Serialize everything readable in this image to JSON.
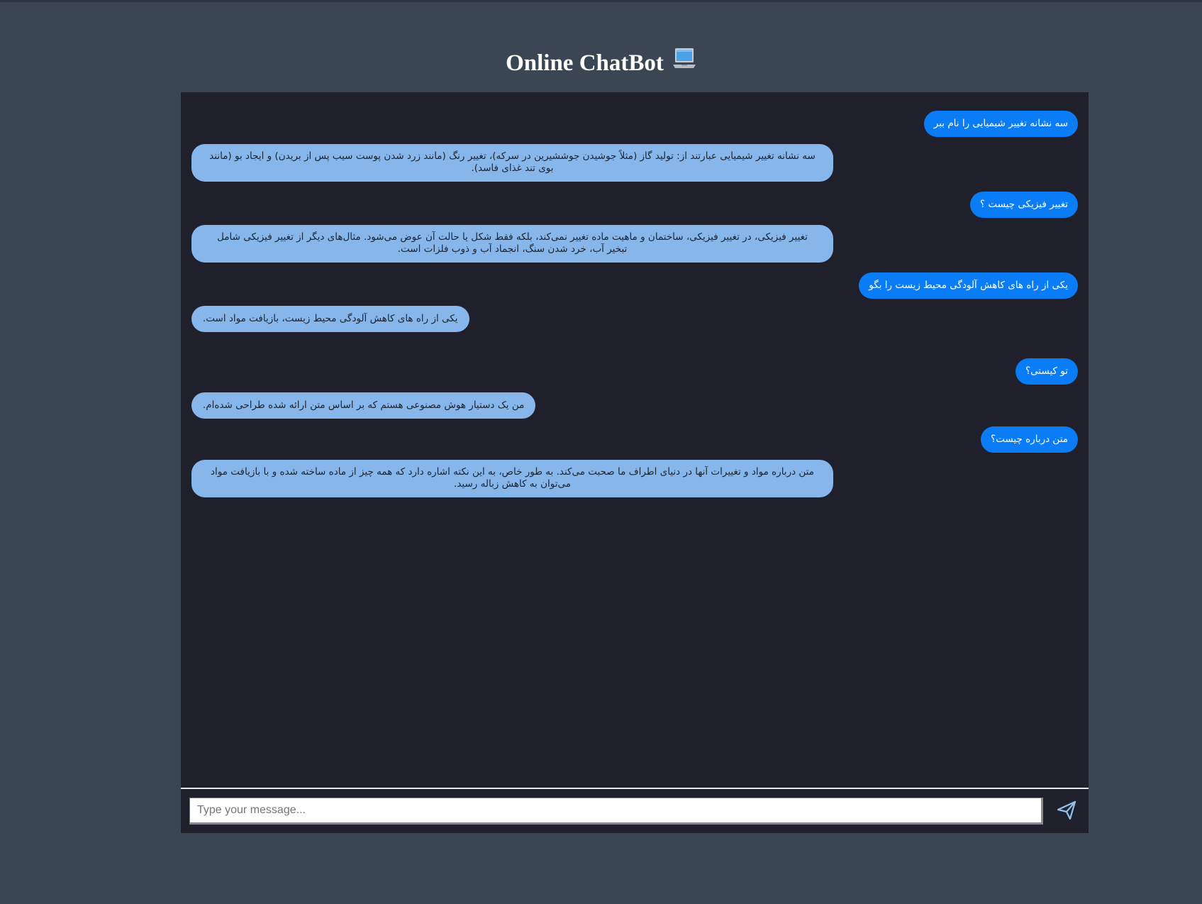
{
  "app": {
    "title": "Online ChatBot",
    "title_icon": "laptop-icon"
  },
  "messages": [
    {
      "role": "user",
      "text": "سه نشانه تغییر شیمیایی را نام ببر"
    },
    {
      "role": "bot",
      "text": "سه نشانه تغییر شیمیایی عبارتند از: تولید گاز (مثلاً جوشیدن جوششیرین در سرکه)، تغییر رنگ (مانند زرد شدن پوست سیب پس از بریدن) و ایجاد بو (مانند بوی تند غذای فاسد)."
    },
    {
      "role": "user",
      "text": "تغییر فیزیکی چیست ؟"
    },
    {
      "role": "bot",
      "text": "تغییر فیزیکی، در تغییر فیزیکی، ساختمان و ماهیت ماده تغییر نمی‌کند، بلکه فقط شکل یا حالت آن عوض می‌شود. مثال‌های دیگر از تغییر فیزیکی شامل تبخیر آب، خرد شدن سنگ، انجماد آب و ذوب فلزات است."
    },
    {
      "role": "user",
      "text": "یکی از راه های کاهش آلودگی محیط زیست را بگو"
    },
    {
      "role": "bot",
      "text": "یکی از راه های کاهش آلودگی محیط زیست، بازیافت مواد است."
    },
    {
      "role": "user",
      "text": "تو کیستی؟"
    },
    {
      "role": "bot",
      "text": "من یک دستیار هوش مصنوعی هستم که بر اساس متن ارائه شده طراحی شده‌ام."
    },
    {
      "role": "user",
      "text": "متن درباره چیست؟"
    },
    {
      "role": "bot",
      "text": "متن درباره مواد و تغییرات آنها در دنیای اطراف ما صحبت می‌کند. به طور خاص، به این نکته اشاره دارد که همه چیز از ماده ساخته شده و با بازیافت مواد می‌توان به کاهش زباله رسید."
    }
  ],
  "input": {
    "placeholder": "Type your message...",
    "value": ""
  },
  "send": {
    "icon": "send-icon"
  },
  "colors": {
    "page_bg": "#3a4654",
    "chat_bg": "#1f202b",
    "user_bubble": "#0a7cf5",
    "bot_bubble": "#87b6eb"
  }
}
